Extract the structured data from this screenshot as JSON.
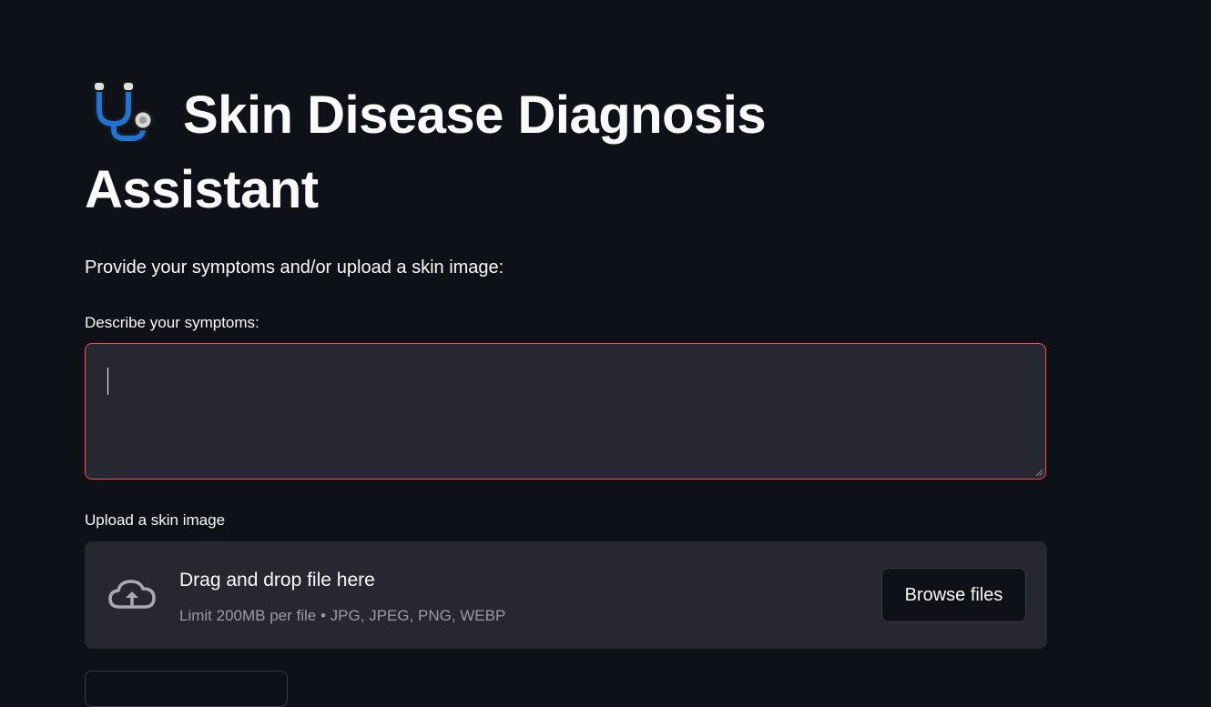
{
  "header": {
    "title_icon": "stethoscope-icon",
    "title": "Skin Disease Diagnosis Assistant"
  },
  "intro": {
    "text": "Provide your symptoms and/or upload a skin image:"
  },
  "symptoms": {
    "label": "Describe your symptoms:",
    "value": "",
    "placeholder": ""
  },
  "upload": {
    "label": "Upload a skin image",
    "icon": "cloud-upload-icon",
    "drop_text": "Drag and drop file here",
    "limit_text": "Limit 200MB per file • JPG, JPEG, PNG, WEBP",
    "browse_label": "Browse files"
  },
  "colors": {
    "background": "#0e1117",
    "input_background": "#262730",
    "focus_border": "#ff4b4b",
    "text": "#fafafa",
    "muted_text": "#9a9ca4",
    "stethoscope_blue": "#1e75d6"
  }
}
